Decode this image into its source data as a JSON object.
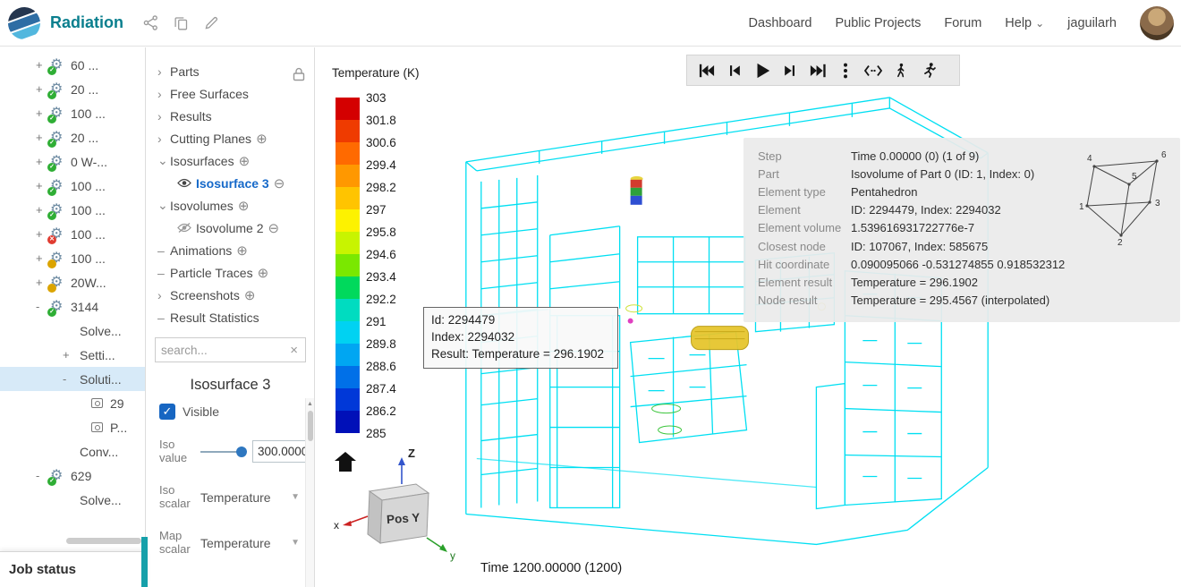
{
  "icons": {
    "gear": "⚙",
    "check": "✓",
    "cross": "✕",
    "add": "⊕",
    "remove": "⊖",
    "close": "×",
    "caret_down": "▼",
    "chevron_down": "⌄",
    "scroll_up": "▲"
  },
  "header": {
    "app_title": "Radiation",
    "nav": [
      {
        "label": "Dashboard"
      },
      {
        "label": "Public Projects"
      },
      {
        "label": "Forum"
      },
      {
        "label": "Help"
      }
    ],
    "username": "jaguilarh"
  },
  "project_tree": {
    "rows": [
      {
        "exp": "+",
        "label": "60 ..."
      },
      {
        "exp": "+",
        "label": "20 ..."
      },
      {
        "exp": "+",
        "label": "100 ..."
      },
      {
        "exp": "+",
        "label": "20 ..."
      },
      {
        "exp": "+",
        "label": "0 W-..."
      },
      {
        "exp": "+",
        "label": "100 ..."
      },
      {
        "exp": "+",
        "label": "100 ..."
      },
      {
        "exp": "+",
        "label": "100 ..."
      },
      {
        "exp": "+",
        "label": "100 ..."
      },
      {
        "exp": "+",
        "label": "20W..."
      },
      {
        "exp": "-",
        "label": "3144"
      },
      {
        "exp": "",
        "label": "Solve..."
      },
      {
        "exp": "+",
        "label": "Setti..."
      },
      {
        "exp": "-",
        "label": "Soluti..."
      },
      {
        "exp": "",
        "label": "29"
      },
      {
        "exp": "",
        "label": "P..."
      },
      {
        "exp": "",
        "label": "Conv..."
      },
      {
        "exp": "-",
        "label": "629"
      },
      {
        "exp": "",
        "label": "Solve..."
      }
    ]
  },
  "job_status": {
    "label": "Job status"
  },
  "post_tree": {
    "rows": [
      {
        "marker": "›",
        "label": "Parts",
        "action": ""
      },
      {
        "marker": "›",
        "label": "Free Surfaces",
        "action": ""
      },
      {
        "marker": "›",
        "label": "Results",
        "action": ""
      },
      {
        "marker": "›",
        "label": "Cutting Planes",
        "action": "⊕"
      },
      {
        "marker": "⌄",
        "label": "Isosurfaces",
        "action": "⊕"
      },
      {
        "marker": "",
        "label": "Isosurface 3",
        "action": "⊖"
      },
      {
        "marker": "⌄",
        "label": "Isovolumes",
        "action": "⊕"
      },
      {
        "marker": "",
        "label": "Isovolume 2",
        "action": "⊖"
      },
      {
        "marker": "–",
        "label": "Animations",
        "action": "⊕"
      },
      {
        "marker": "–",
        "label": "Particle Traces",
        "action": "⊕"
      },
      {
        "marker": "›",
        "label": "Screenshots",
        "action": "⊕"
      },
      {
        "marker": "–",
        "label": "Result Statistics",
        "action": ""
      }
    ],
    "search_placeholder": "search..."
  },
  "properties": {
    "title": "Isosurface 3",
    "visible_label": "Visible",
    "iso_value_label": "Iso value",
    "iso_value": "300.0000",
    "iso_scalar_label": "Iso scalar",
    "iso_scalar_value": "Temperature",
    "map_scalar_label": "Map scalar",
    "map_scalar_value": "Temperature"
  },
  "viewport": {
    "legend": {
      "title": "Temperature (K)",
      "ticks": [
        "303",
        "301.8",
        "300.6",
        "299.4",
        "298.2",
        "297",
        "295.8",
        "294.6",
        "293.4",
        "292.2",
        "291",
        "289.8",
        "288.6",
        "287.4",
        "286.2",
        "285"
      ],
      "colors": [
        "#d40000",
        "#ef3b00",
        "#ff6a00",
        "#ff9800",
        "#ffc400",
        "#fdf200",
        "#c8f400",
        "#7ae800",
        "#00d95c",
        "#00dcc0",
        "#00d2f2",
        "#00a6f2",
        "#0070e8",
        "#0038d8",
        "#0010b8"
      ]
    },
    "tooltip": {
      "line1": "Id: 2294479",
      "line2": "Index: 2294032",
      "line3": "Result: Temperature = 296.1902"
    },
    "info": {
      "rows": [
        {
          "label": "Step",
          "value": "Time 0.00000 (0) (1 of 9)"
        },
        {
          "label": "Part",
          "value": "Isovolume of Part 0 (ID: 1, Index: 0)"
        },
        {
          "label": "Element type",
          "value": "Pentahedron"
        },
        {
          "label": "Element",
          "value": "ID: 2294479, Index: 2294032"
        },
        {
          "label": "Element volume",
          "value": "1.539616931722776e-7"
        },
        {
          "label": "Closest node",
          "value": "ID: 107067, Index: 585675"
        },
        {
          "label": "Hit coordinate",
          "value": "0.090095066 -0.531274855 0.918532312"
        },
        {
          "label": "Element result",
          "value": "Temperature = 296.1902"
        },
        {
          "label": "Node result",
          "value": "Temperature = 295.4567 (interpolated)"
        }
      ],
      "diagram_nodes": [
        "1",
        "2",
        "3",
        "4",
        "5",
        "6"
      ]
    },
    "nav_cube": {
      "face_label": "Pos Y",
      "x": "x",
      "y": "y",
      "z": "Z"
    },
    "time_label": "Time 1200.00000 (1200)"
  }
}
